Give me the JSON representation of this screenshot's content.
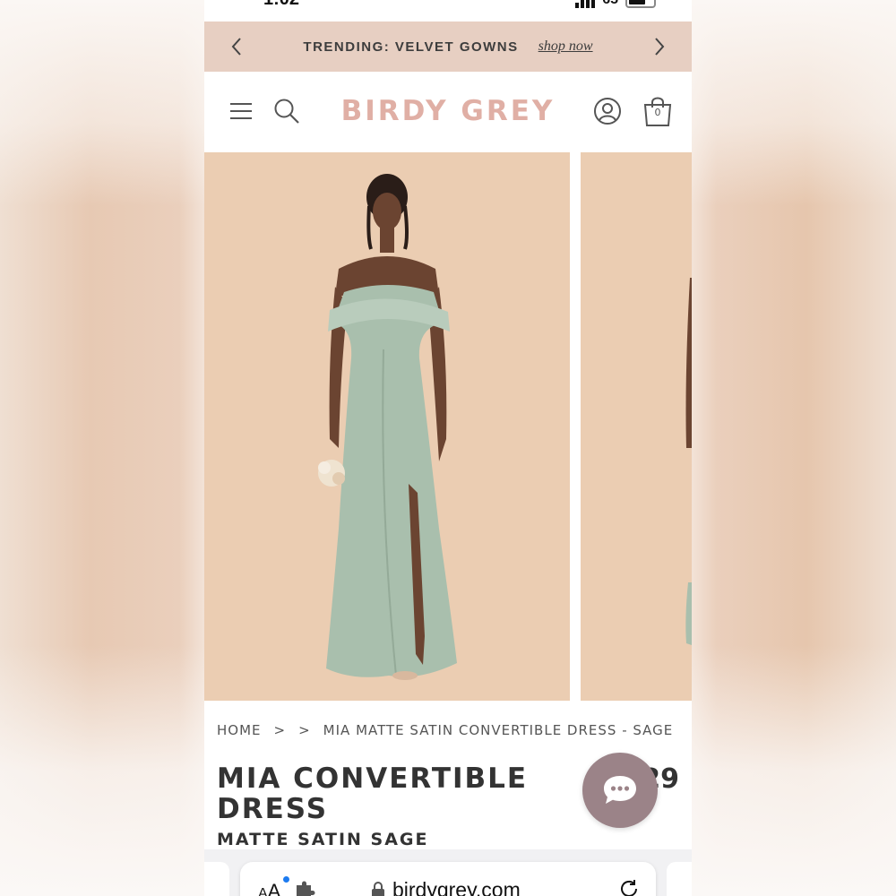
{
  "status_bar": {
    "time": "1:02",
    "battery_level": "65"
  },
  "promo": {
    "text": "TRENDING: VELVET GOWNS",
    "link": "shop now",
    "prev_icon": "chevron-left-icon",
    "next_icon": "chevron-right-icon"
  },
  "header": {
    "logo": "BIRDY GREY",
    "icons": [
      "hamburger-menu-icon",
      "search-icon",
      "account-icon",
      "shopping-bag-icon"
    ],
    "cart_count": "0"
  },
  "gallery": {
    "main_photo": "Model wearing sage off-shoulder satin gown holding a small bouquet",
    "next_photo": "Second product photo (partially visible)"
  },
  "breadcrumb": {
    "home": "HOME",
    "sep1": ">",
    "sep2": ">",
    "current": "MIA MATTE SATIN CONVERTIBLE DRESS - SAGE"
  },
  "product": {
    "title": "MIA CONVERTIBLE DRESS",
    "subtitle": "MATTE SATIN SAGE",
    "price_visible": "29"
  },
  "chat": {
    "icon": "chat-bubble-icon"
  },
  "browser": {
    "aa_label": "AA",
    "url": "birdygrey.com",
    "icons": [
      "puzzle-extension-icon",
      "lock-icon",
      "reload-icon"
    ]
  },
  "colors": {
    "promo_bg": "#e7cfc2",
    "logo": "#e0afa5",
    "photo_bg": "#ebcdb2",
    "chat_bg": "#9b8388",
    "dress": "#a9bfad"
  }
}
